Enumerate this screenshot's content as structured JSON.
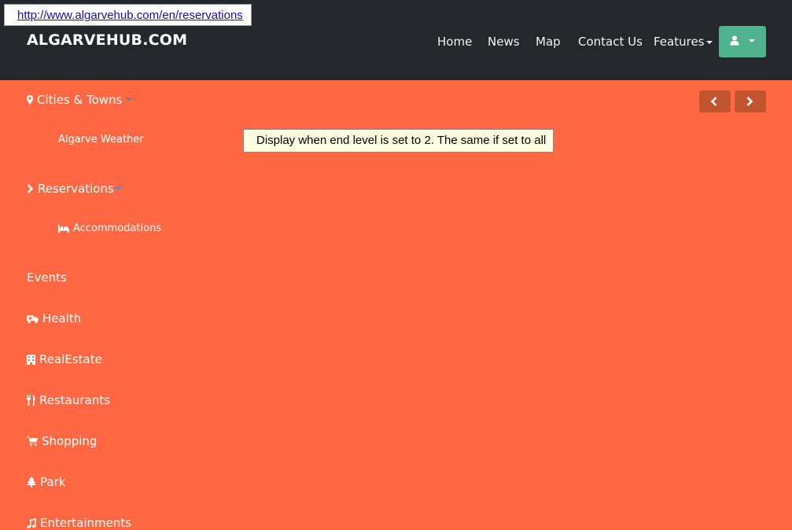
{
  "status_url": "http://www.algarvehub.com/en/reservations",
  "brand": "ALGARVEHUB.COM",
  "nav": {
    "home": "Home",
    "news": "News",
    "map": "Map",
    "contact": "Contact Us",
    "features": "Features"
  },
  "user_menu_icon": "user-icon",
  "pager": {
    "prev_icon": "chevron-left-icon",
    "next_icon": "chevron-right-icon"
  },
  "menu": {
    "cities": "Cities & Towns",
    "weather": "Algarve Weather",
    "reservations": "Reservations",
    "accommodations": "Accommodations",
    "events": "Events",
    "health": "Health",
    "realestate": "RealEstate",
    "restaurants": "Restaurants",
    "shopping": "Shopping",
    "park": "Park",
    "entertainments": "Entertainments"
  },
  "tooltip": "Display when end level is set to 2. The same if set to all",
  "colors": {
    "topbar": "#24272b",
    "background": "#ff6843",
    "user_button": "#4fb38f",
    "arrow_button": "#c2542f"
  }
}
